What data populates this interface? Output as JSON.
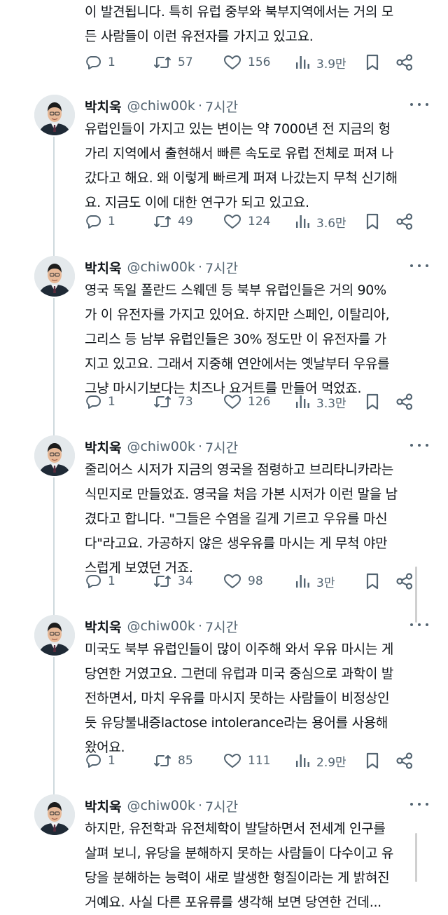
{
  "top_fragment": {
    "lines": [
      "이 발견됩니다. 특히 유럽 중부와 북부지역에서는 거의 모",
      "든 사람들이 이런 유전자를 가지고 있고요."
    ],
    "stats": {
      "replies": "1",
      "retweets": "57",
      "likes": "156",
      "views": "3.9만"
    }
  },
  "tweets": [
    {
      "name": "박치욱",
      "handle": "@chiw00k",
      "sep": "·",
      "time": "7시간",
      "lines": [
        "유럽인들이 가지고 있는 변이는 약 7000년 전 지금의 헝",
        "가리 지역에서 출현해서 빠른 속도로 유럽 전체로 퍼져 나",
        "갔다고 해요. 왜 이렇게 빠르게 퍼져 나갔는지 무척 신기해",
        "요. 지금도 이에 대한 연구가 되고 있고요."
      ],
      "stats": {
        "replies": "1",
        "retweets": "49",
        "likes": "124",
        "views": "3.6만"
      }
    },
    {
      "name": "박치욱",
      "handle": "@chiw00k",
      "sep": "·",
      "time": "7시간",
      "lines": [
        "영국 독일 폴란드 스웨덴 등 북부 유럽인들은 거의 90%",
        "가 이 유전자를 가지고 있어요. 하지만 스페인, 이탈리아,",
        "그리스 등 남부 유럽인들은 30% 정도만 이 유전자를 가",
        "지고 있고요. 그래서 지중해 연안에서는 옛날부터 우유를",
        "그냥 마시기보다는 치즈나 요거트를 만들어 먹었죠."
      ],
      "stats": {
        "replies": "1",
        "retweets": "73",
        "likes": "126",
        "views": "3.3만"
      }
    },
    {
      "name": "박치욱",
      "handle": "@chiw00k",
      "sep": "·",
      "time": "7시간",
      "lines": [
        "줄리어스 시저가 지금의 영국을 점령하고 브리타니카라는",
        "식민지로 만들었죠. 영국을 처음 가본 시저가 이런 말을 남",
        "겼다고 합니다. \"그들은 수염을 길게 기르고 우유를 마신",
        "다\"라고요. 가공하지 않은 생우유를 마시는 게 무척 야만",
        "스럽게 보였던 거죠."
      ],
      "stats": {
        "replies": "1",
        "retweets": "34",
        "likes": "98",
        "views": "3만"
      }
    },
    {
      "name": "박치욱",
      "handle": "@chiw00k",
      "sep": "·",
      "time": "7시간",
      "lines": [
        "미국도 북부 유럽인들이 많이 이주해 와서 우유 마시는 게",
        "당연한 거였고요. 그런데 유럽과 미국 중심으로 과학이 발",
        "전하면서, 마치 우유를 마시지 못하는 사람들이 비정상인",
        "듯 유당불내증lactose intolerance라는 용어를 사용해",
        "왔어요."
      ],
      "stats": {
        "replies": "1",
        "retweets": "85",
        "likes": "111",
        "views": "2.9만"
      }
    },
    {
      "name": "박치욱",
      "handle": "@chiw00k",
      "sep": "·",
      "time": "7시간",
      "lines": [
        "하지만, 유전학과 유전체학이 발달하면서 전세계 인구를",
        "살펴 보니, 유당을 분해하지 못하는 사람들이 다수이고 유",
        "당을 분해하는 능력이 새로 발생한 형질이라는 게 밝혀진",
        "거예요. 사실 다른 포유류를 생각해 보면 당연한 건데..."
      ],
      "stats": null
    }
  ],
  "icons": [
    "reply-icon",
    "retweet-icon",
    "like-icon",
    "views-icon",
    "bookmark-icon",
    "share-icon",
    "more-icon"
  ],
  "colors": {
    "text": "#0f1419",
    "secondary": "#536471",
    "thread_line": "#cfd9de"
  }
}
